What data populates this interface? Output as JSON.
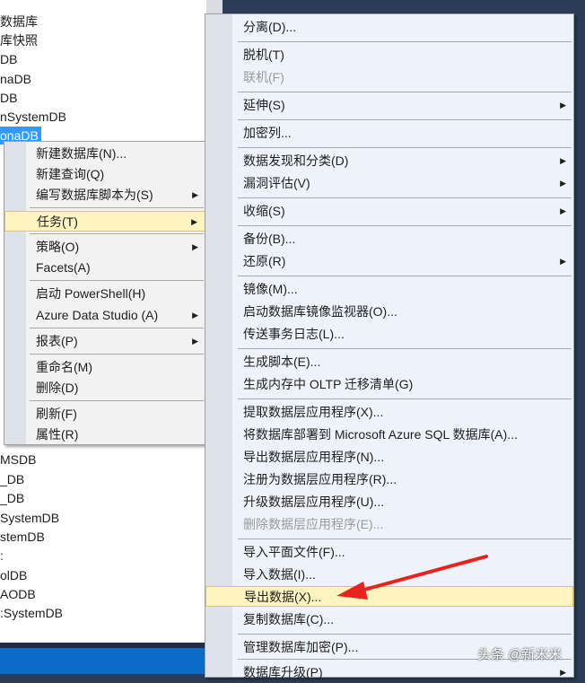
{
  "tree": {
    "items": [
      "数据库",
      "库快照",
      "DB",
      "naDB",
      "DB",
      "nSystemDB",
      "onaDB",
      "MSDB",
      "_DB",
      "_DB",
      "SystemDB",
      "stemDB",
      ":",
      "olDB",
      "AODB",
      ":SystemDB"
    ],
    "selected_index": 6
  },
  "context_menu": {
    "items": [
      {
        "label": "新建数据库(N)..."
      },
      {
        "label": "新建查询(Q)"
      },
      {
        "label": "编写数据库脚本为(S)",
        "submenu": true
      },
      {
        "label": "任务(T)",
        "submenu": true,
        "highlighted": true
      },
      {
        "label": "策略(O)",
        "submenu": true
      },
      {
        "label": "Facets(A)"
      },
      {
        "label": "启动 PowerShell(H)"
      },
      {
        "label": "Azure Data Studio (A)",
        "submenu": true
      },
      {
        "label": "报表(P)",
        "submenu": true
      },
      {
        "label": "重命名(M)"
      },
      {
        "label": "删除(D)"
      },
      {
        "label": "刷新(F)"
      },
      {
        "label": "属性(R)"
      }
    ]
  },
  "tasks_menu": {
    "items": [
      {
        "label": "分离(D)..."
      },
      {
        "label": "脱机(T)"
      },
      {
        "label": "联机(F)",
        "disabled": true
      },
      {
        "label": "延伸(S)",
        "submenu": true
      },
      {
        "label": "加密列..."
      },
      {
        "label": "数据发现和分类(D)",
        "submenu": true
      },
      {
        "label": "漏洞评估(V)",
        "submenu": true
      },
      {
        "label": "收缩(S)",
        "submenu": true
      },
      {
        "label": "备份(B)..."
      },
      {
        "label": "还原(R)",
        "submenu": true
      },
      {
        "label": "镜像(M)..."
      },
      {
        "label": "启动数据库镜像监视器(O)..."
      },
      {
        "label": "传送事务日志(L)..."
      },
      {
        "label": "生成脚本(E)..."
      },
      {
        "label": "生成内存中 OLTP 迁移清单(G)"
      },
      {
        "label": "提取数据层应用程序(X)..."
      },
      {
        "label": "将数据库部署到 Microsoft Azure SQL 数据库(A)..."
      },
      {
        "label": "导出数据层应用程序(N)..."
      },
      {
        "label": "注册为数据层应用程序(R)..."
      },
      {
        "label": "升级数据层应用程序(U)..."
      },
      {
        "label": "删除数据层应用程序(E)...",
        "disabled": true
      },
      {
        "label": "导入平面文件(F)..."
      },
      {
        "label": "导入数据(I)..."
      },
      {
        "label": "导出数据(X)...",
        "highlighted": true
      },
      {
        "label": "复制数据库(C)..."
      },
      {
        "label": "管理数据库加密(P)..."
      },
      {
        "label": "数据库升级(P)",
        "submenu": true
      }
    ]
  },
  "watermark": "头条 @新米米",
  "colors": {
    "arrow": "#e8231d",
    "highlight": "#fdf4bf",
    "selection": "#3399ff"
  }
}
